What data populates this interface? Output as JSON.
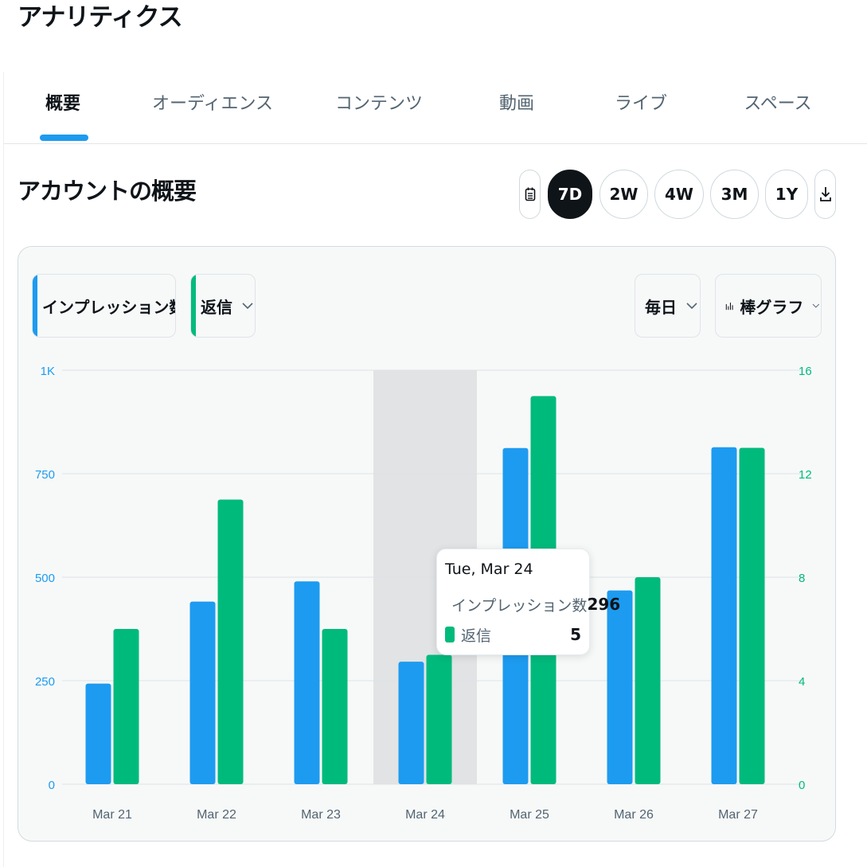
{
  "page_title": "アナリティクス",
  "tabs": [
    {
      "label": "概要",
      "active": true
    },
    {
      "label": "オーディエンス",
      "active": false
    },
    {
      "label": "コンテンツ",
      "active": false
    },
    {
      "label": "動画",
      "active": false
    },
    {
      "label": "ライブ",
      "active": false
    },
    {
      "label": "スペース",
      "active": false
    }
  ],
  "section_title": "アカウントの概要",
  "range_buttons": [
    {
      "label": "7D",
      "active": true
    },
    {
      "label": "2W",
      "active": false
    },
    {
      "label": "4W",
      "active": false
    },
    {
      "label": "3M",
      "active": false
    },
    {
      "label": "1Y",
      "active": false
    }
  ],
  "icons": {
    "calendar": "calendar-icon",
    "download": "download-icon",
    "chevron": "chevron-down-icon",
    "bar_chart": "bar-chart-icon"
  },
  "controls": {
    "metric_primary": "インプレッション数",
    "metric_secondary": "返信",
    "interval": "毎日",
    "chart_type_label": "棒グラフ"
  },
  "colors": {
    "impressions": "#1d9bf0",
    "replies": "#00ba7c",
    "hover_band": "#e1e3e5",
    "active_tab": "#1d9bf0"
  },
  "chart_data": {
    "type": "bar",
    "categories": [
      "Mar 21",
      "Mar 22",
      "Mar 23",
      "Mar 24",
      "Mar 25",
      "Mar 26",
      "Mar 27"
    ],
    "series": [
      {
        "name": "インプレッション数",
        "values": [
          243,
          441,
          490,
          296,
          812,
          468,
          814
        ],
        "axis": "left"
      },
      {
        "name": "返信",
        "values": [
          6,
          11,
          6,
          5,
          15,
          8,
          13
        ],
        "axis": "right"
      }
    ],
    "y_left": {
      "ticks": [
        "0",
        "250",
        "500",
        "750",
        "1K"
      ],
      "range": [
        0,
        1000
      ]
    },
    "y_right": {
      "ticks": [
        "0",
        "4",
        "8",
        "12",
        "16"
      ],
      "range": [
        0,
        16
      ]
    },
    "grid": true,
    "highlight_index": 3
  },
  "tooltip": {
    "title": "Tue, Mar 24",
    "rows": [
      {
        "name": "インプレッション数",
        "value": "296"
      },
      {
        "name": "返信",
        "value": "5"
      }
    ]
  }
}
